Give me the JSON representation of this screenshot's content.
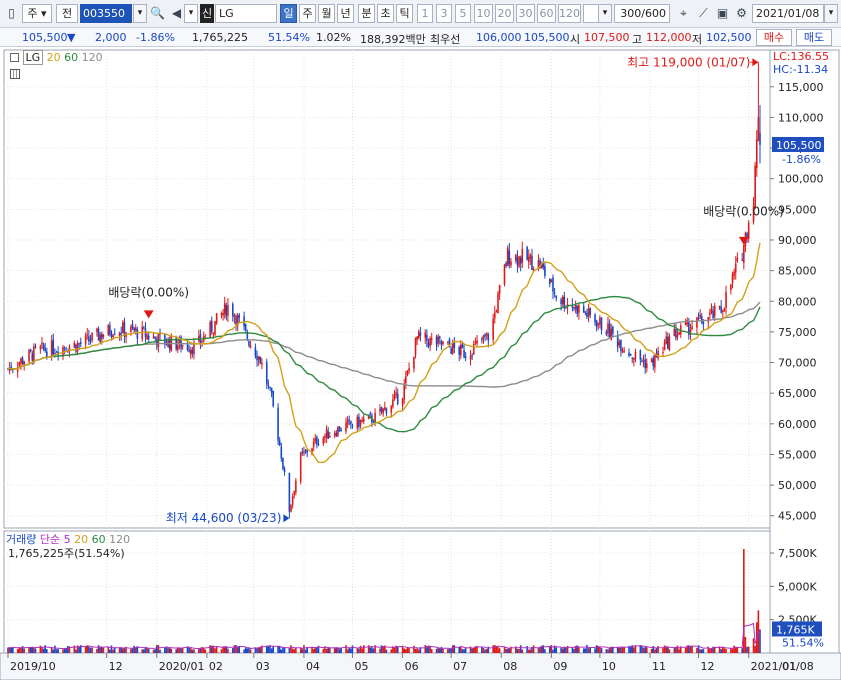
{
  "toolbar": {
    "market_label": "주",
    "period_label": "전",
    "stock_code": "003550",
    "credit_badge": "신",
    "stock_name": "LG",
    "period_tabs": [
      "일",
      "주",
      "월",
      "년",
      "분",
      "초",
      "틱"
    ],
    "selected_tab": "일",
    "interval_buttons": [
      "1",
      "3",
      "5",
      "10",
      "20",
      "30",
      "60",
      "120"
    ],
    "count_value": "300",
    "count_total": "/600",
    "date_value": "2021/01/08"
  },
  "quote": {
    "price": "105,500",
    "change": "2,000",
    "change_pct": "-1.86%",
    "volume": "1,765,225",
    "volume_ratio": "51.54%",
    "turnover": "1.02%",
    "amount": "188,392백만",
    "best_label": "최우선",
    "ask": "106,000",
    "bid": "105,500",
    "open_label": "시",
    "open": "107,500",
    "high_label": "고",
    "high": "112,000",
    "low_label": "저",
    "low": "102,500",
    "buy_label": "매수",
    "sell_label": "매도"
  },
  "price_panel": {
    "legend_name": "LG",
    "ma_periods": [
      "20",
      "60",
      "120"
    ],
    "ma_colors": [
      "#d4a017",
      "#2e8b3d",
      "#8c8c8c"
    ],
    "lc_label": "LC:136.55",
    "hc_label": "HC:-11.34",
    "current_price_label": "105,500",
    "current_change_label": "-1.86%",
    "high_annotation": "최고 119,000 (01/07)",
    "low_annotation": "최저 44,600 (03/23)",
    "dividend_label_1": "배당락(0.00%)",
    "dividend_label_2": "배당락(0.00%)"
  },
  "volume_panel": {
    "legend_name": "거래량",
    "ma_type": "단순",
    "ma_periods": [
      "5",
      "20",
      "60",
      "120"
    ],
    "ma_colors": [
      "#b030c0",
      "#d4a017",
      "#2e8b3d",
      "#8c8c8c"
    ],
    "info": "1,765,225주(51.54%)",
    "current_label": "1,765K",
    "current_pct_label": "51.54%"
  },
  "colors": {
    "up": "#e01818",
    "down": "#1848c8",
    "grid": "#e3e3e3"
  },
  "chart_data": {
    "type": "candlestick",
    "price_axis": {
      "ticks": [
        45000,
        50000,
        55000,
        60000,
        65000,
        70000,
        75000,
        80000,
        85000,
        90000,
        95000,
        100000,
        105000,
        110000,
        115000
      ],
      "tick_labels": [
        "45,000",
        "50,000",
        "55,000",
        "60,000",
        "65,000",
        "70,000",
        "75,000",
        "80,000",
        "85,000",
        "90,000",
        "95,000",
        "100,000",
        "105,000",
        "110,000",
        "115,000"
      ],
      "range": [
        43000,
        121000
      ]
    },
    "volume_axis": {
      "ticks": [
        2500,
        5000,
        7500
      ],
      "tick_labels": [
        "2,500K",
        "5,000K",
        "7,500K"
      ],
      "range": [
        0,
        8700
      ]
    },
    "x_axis": {
      "labels": [
        "2019/10",
        "12",
        "2020/01",
        "02",
        "03",
        "04",
        "05",
        "06",
        "07",
        "08",
        "09",
        "10",
        "11",
        "12",
        "2021/01",
        "01/08"
      ],
      "range": [
        "2019/10/01",
        "2021/01/08"
      ]
    },
    "high_point": {
      "date": "2021/01/07",
      "value": 119000
    },
    "low_point": {
      "date": "2020/03/23",
      "value": 44600
    },
    "dividend_dates": [
      "2019/12/27",
      "2020/12/29"
    ],
    "price_path": [
      [
        "2019/10/01",
        69000
      ],
      [
        "2019/10/20",
        72000
      ],
      [
        "2019/11/15",
        73000
      ],
      [
        "2019/12/05",
        75500
      ],
      [
        "2019/12/20",
        75000
      ],
      [
        "2020/01/05",
        73500
      ],
      [
        "2020/01/25",
        72500
      ],
      [
        "2020/02/05",
        76000
      ],
      [
        "2020/02/15",
        79500
      ],
      [
        "2020/02/25",
        74500
      ],
      [
        "2020/03/05",
        70500
      ],
      [
        "2020/03/12",
        64000
      ],
      [
        "2020/03/18",
        55000
      ],
      [
        "2020/03/23",
        46000
      ],
      [
        "2020/03/30",
        54500
      ],
      [
        "2020/04/10",
        57500
      ],
      [
        "2020/04/25",
        59500
      ],
      [
        "2020/05/15",
        61000
      ],
      [
        "2020/06/01",
        65000
      ],
      [
        "2020/06/10",
        74000
      ],
      [
        "2020/06/25",
        73000
      ],
      [
        "2020/07/10",
        71500
      ],
      [
        "2020/07/25",
        74500
      ],
      [
        "2020/08/05",
        87500
      ],
      [
        "2020/08/15",
        87000
      ],
      [
        "2020/08/25",
        86000
      ],
      [
        "2020/09/05",
        80500
      ],
      [
        "2020/09/20",
        78500
      ],
      [
        "2020/10/05",
        75500
      ],
      [
        "2020/10/20",
        71500
      ],
      [
        "2020/11/01",
        69500
      ],
      [
        "2020/11/15",
        74500
      ],
      [
        "2020/12/01",
        76500
      ],
      [
        "2020/12/15",
        78500
      ],
      [
        "2020/12/28",
        88000
      ],
      [
        "2021/01/04",
        97000
      ],
      [
        "2021/01/07",
        110000
      ],
      [
        "2021/01/08",
        105500
      ]
    ],
    "volume_spikes": [
      [
        "2020/12/29",
        7800
      ],
      [
        "2020/12/30",
        1200
      ],
      [
        "2021/01/04",
        1100
      ],
      [
        "2021/01/06",
        2300
      ],
      [
        "2021/01/07",
        3200
      ],
      [
        "2021/01/08",
        1765
      ]
    ],
    "series": [
      {
        "name": "20",
        "values_note": "moving average of close"
      },
      {
        "name": "60",
        "values_note": "moving average of close"
      },
      {
        "name": "120",
        "values_note": "moving average of close"
      }
    ]
  }
}
